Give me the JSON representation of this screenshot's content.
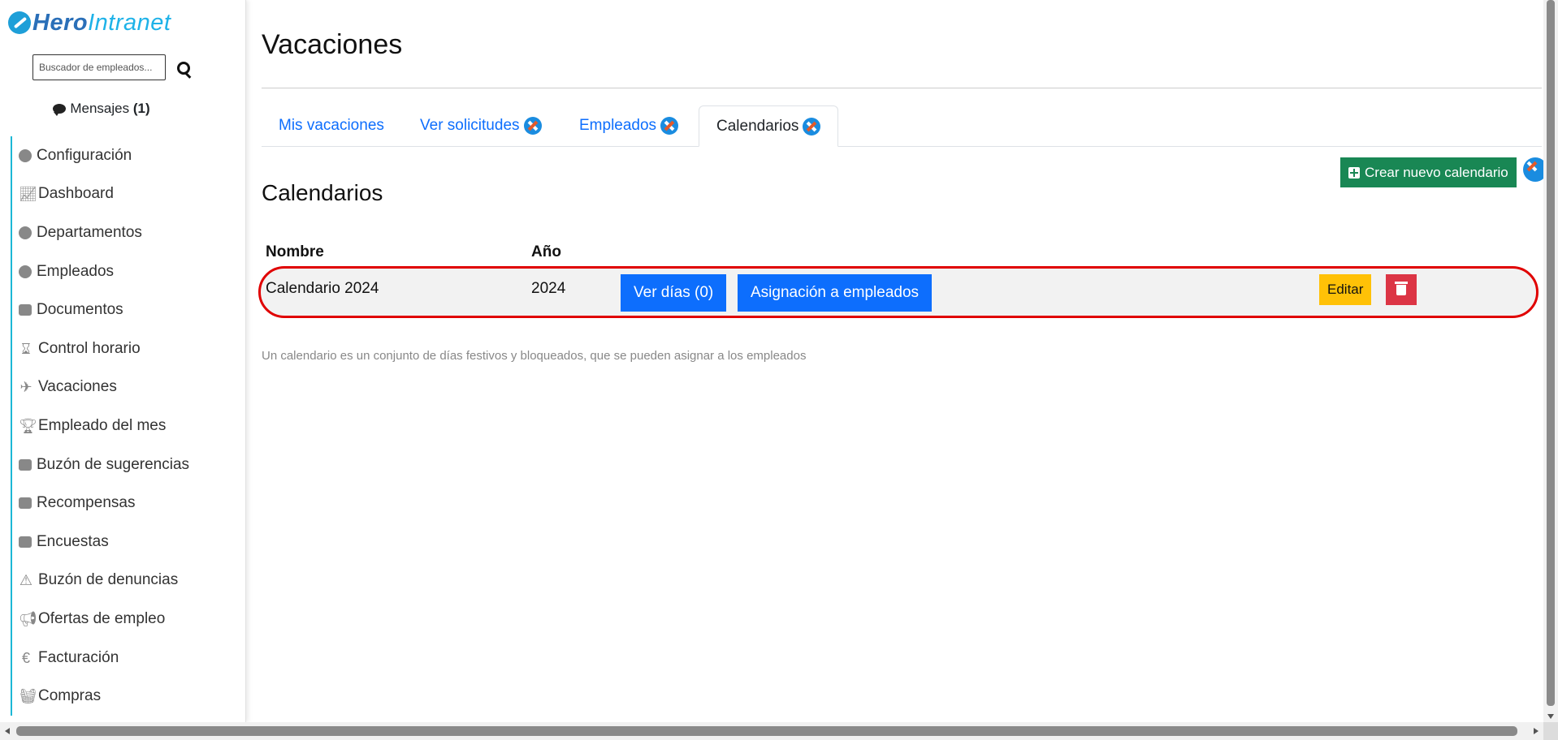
{
  "brand": {
    "hero": "Hero",
    "intranet": "Intranet"
  },
  "search": {
    "placeholder": "Buscador de empleados..."
  },
  "messages": {
    "label": "Mensajes",
    "count": "(1)"
  },
  "sidebar": {
    "items": [
      {
        "label": "Configuración",
        "icon": "gear-icon"
      },
      {
        "label": "Dashboard",
        "icon": "chart-line-icon"
      },
      {
        "label": "Departamentos",
        "icon": "users-icon"
      },
      {
        "label": "Empleados",
        "icon": "user-icon"
      },
      {
        "label": "Documentos",
        "icon": "folder-icon"
      },
      {
        "label": "Control horario",
        "icon": "hourglass-icon"
      },
      {
        "label": "Vacaciones",
        "icon": "plane-icon"
      },
      {
        "label": "Empleado del mes",
        "icon": "trophy-icon"
      },
      {
        "label": "Buzón de sugerencias",
        "icon": "envelope-open-icon"
      },
      {
        "label": "Recompensas",
        "icon": "gifts-icon"
      },
      {
        "label": "Encuestas",
        "icon": "clipboard-icon"
      },
      {
        "label": "Buzón de denuncias",
        "icon": "warning-icon"
      },
      {
        "label": "Ofertas de empleo",
        "icon": "bullhorn-icon"
      },
      {
        "label": "Facturación",
        "icon": "euro-icon"
      },
      {
        "label": "Compras",
        "icon": "basket-icon"
      }
    ]
  },
  "page": {
    "title": "Vacaciones"
  },
  "tabs": [
    {
      "label": "Mis vacaciones",
      "tool": false
    },
    {
      "label": "Ver solicitudes",
      "tool": true
    },
    {
      "label": "Empleados",
      "tool": true
    },
    {
      "label": "Calendarios",
      "tool": true,
      "active": true
    }
  ],
  "section": {
    "title": "Calendarios",
    "create_label": "Crear nuevo calendario"
  },
  "table": {
    "headers": {
      "name": "Nombre",
      "year": "Año"
    },
    "rows": [
      {
        "name": "Calendario 2024",
        "year": "2024",
        "view_days": "Ver días (0)",
        "assign": "Asignación a empleados",
        "edit": "Editar"
      }
    ]
  },
  "help_text": "Un calendario es un conjunto de días festivos y bloqueados, que se pueden asignar a los empleados",
  "colors": {
    "primary": "#0d6efd",
    "success": "#198754",
    "warning": "#ffc107",
    "danger": "#dc3545",
    "highlight": "#e00000"
  }
}
